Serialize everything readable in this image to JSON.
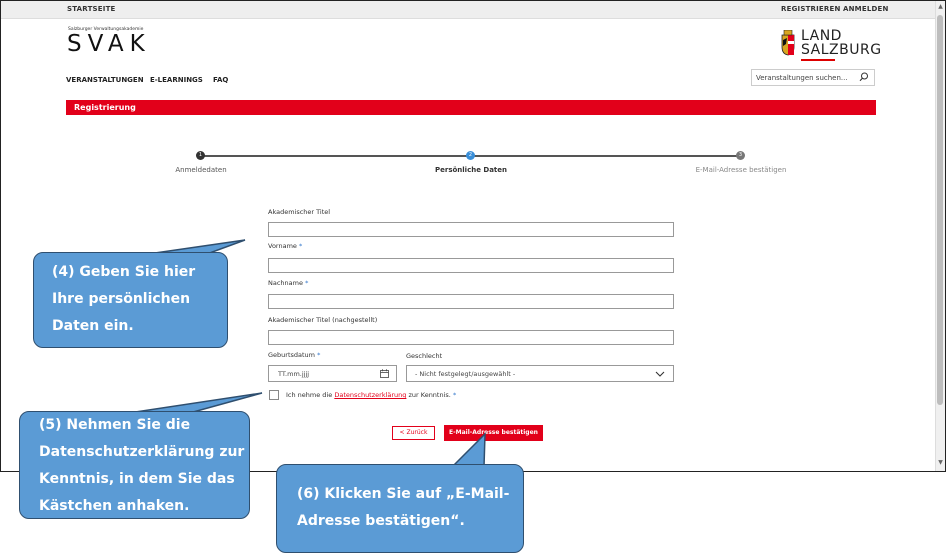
{
  "topbar": {
    "home": "STARTSEITE",
    "register": "REGISTRIEREN",
    "login": "ANMELDEN"
  },
  "logo": {
    "subtitle": "Salzburger Verwaltungsakademie",
    "name": "SVAK"
  },
  "land_logo": {
    "line1": "LAND",
    "line2": "SALZBURG"
  },
  "nav": {
    "items": [
      "VERANSTALTUNGEN",
      "E-LEARNINGS",
      "FAQ"
    ]
  },
  "search": {
    "placeholder": "Veranstaltungen suchen..."
  },
  "page": {
    "title": "Registrierung"
  },
  "steps": [
    {
      "number": "1",
      "label": "Anmeldedaten",
      "state": "done"
    },
    {
      "number": "2",
      "label": "Persönliche Daten",
      "state": "active"
    },
    {
      "number": "3",
      "label": "E-Mail-Adresse bestätigen",
      "state": "pending"
    }
  ],
  "form": {
    "academic_title_label": "Akademischer Titel",
    "first_name_label": "Vorname",
    "last_name_label": "Nachname",
    "academic_title_post_label": "Akademischer Titel (nachgestellt)",
    "birthdate_label": "Geburtsdatum",
    "birthdate_placeholder": "TT.mm.jjjj",
    "gender_label": "Geschlecht",
    "gender_selected": "- Nicht festgelegt/ausgewählt -",
    "required_mark": "*",
    "consent_prefix": "Ich nehme die",
    "consent_link": "Datenschutzerklärung",
    "consent_suffix": "zur Kenntnis."
  },
  "buttons": {
    "back": "< Zurück",
    "confirm": "E-Mail-Adresse bestätigen"
  },
  "callouts": {
    "c4": [
      "(4) Geben Sie hier",
      "Ihre persönlichen",
      "Daten ein."
    ],
    "c5": [
      "(5) Nehmen Sie die",
      "Datenschutzerklärung zur",
      "Kenntnis, in dem Sie das",
      "Kästchen anhaken."
    ],
    "c6": [
      "(6) Klicken Sie auf „E-Mail-",
      "Adresse bestätigen“."
    ]
  },
  "colors": {
    "brand_red": "#e2001a",
    "step_active": "#3a8fd9",
    "step_done": "#333333",
    "callout_fill": "#5b9bd5",
    "callout_border": "#2f4f6f"
  }
}
